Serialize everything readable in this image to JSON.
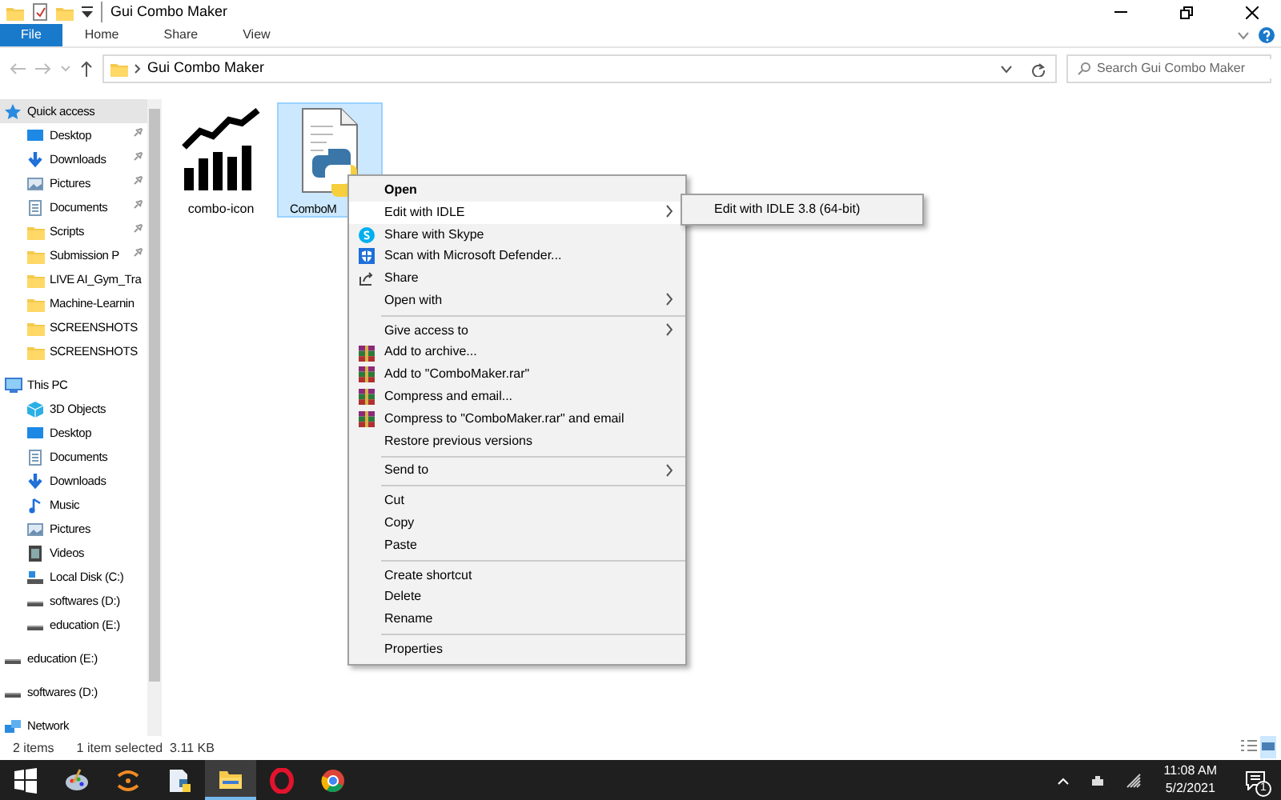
{
  "window": {
    "title": "Gui Combo Maker"
  },
  "ribbon_tabs": [
    {
      "label": "File",
      "selected": true
    },
    {
      "label": "Home",
      "selected": false
    },
    {
      "label": "Share",
      "selected": false
    },
    {
      "label": "View",
      "selected": false
    }
  ],
  "address": {
    "path": "Gui Combo Maker"
  },
  "search": {
    "placeholder": "Search Gui Combo Maker"
  },
  "sidebar": {
    "items": [
      {
        "label": "Quick access",
        "kind": "star",
        "selected": true,
        "children": [
          {
            "label": "Desktop",
            "kind": "desktop",
            "pinned": true
          },
          {
            "label": "Downloads",
            "kind": "download",
            "pinned": true
          },
          {
            "label": "Pictures",
            "kind": "pictures",
            "pinned": true
          },
          {
            "label": "Documents",
            "kind": "documents",
            "pinned": true
          },
          {
            "label": "Scripts",
            "kind": "folder",
            "pinned": true
          },
          {
            "label": "Submission P",
            "kind": "folder",
            "pinned": true
          },
          {
            "label": "LIVE AI_Gym_Tra",
            "kind": "folder",
            "pinned": false
          },
          {
            "label": "Machine-Learnin",
            "kind": "folder",
            "pinned": false
          },
          {
            "label": "SCREENSHOTS",
            "kind": "folder",
            "pinned": false
          },
          {
            "label": "SCREENSHOTS",
            "kind": "folder",
            "pinned": false
          }
        ]
      },
      {
        "label": "This PC",
        "kind": "pc",
        "selected": false,
        "children": [
          {
            "label": "3D Objects",
            "kind": "cube",
            "pinned": false
          },
          {
            "label": "Desktop",
            "kind": "desktop",
            "pinned": false
          },
          {
            "label": "Documents",
            "kind": "documents",
            "pinned": false
          },
          {
            "label": "Downloads",
            "kind": "download",
            "pinned": false
          },
          {
            "label": "Music",
            "kind": "music",
            "pinned": false
          },
          {
            "label": "Pictures",
            "kind": "pictures",
            "pinned": false
          },
          {
            "label": "Videos",
            "kind": "videos",
            "pinned": false
          },
          {
            "label": "Local Disk (C:)",
            "kind": "disk",
            "pinned": false
          },
          {
            "label": "softwares (D:)",
            "kind": "drive",
            "pinned": false
          },
          {
            "label": "education (E:)",
            "kind": "drive",
            "pinned": false
          }
        ]
      },
      {
        "label": "education (E:)",
        "kind": "drive",
        "selected": false
      },
      {
        "label": "softwares (D:)",
        "kind": "drive",
        "selected": false
      },
      {
        "label": "Network",
        "kind": "network",
        "selected": false
      }
    ]
  },
  "files": [
    {
      "label": "combo-icon",
      "kind": "chart",
      "selected": false
    },
    {
      "label": "ComboM",
      "kind": "python",
      "selected": true
    }
  ],
  "context_menu": [
    {
      "label": "Open",
      "kind": "plain",
      "default": true,
      "submenu": false,
      "selected": false
    },
    {
      "label": "Edit with IDLE",
      "kind": "plain",
      "default": false,
      "submenu": true,
      "selected": true
    },
    {
      "label": "Share with Skype",
      "kind": "skype",
      "default": false,
      "submenu": false,
      "selected": false
    },
    {
      "label": "Scan with Microsoft Defender...",
      "kind": "defender",
      "default": false,
      "submenu": false,
      "selected": false
    },
    {
      "label": "Share",
      "kind": "share",
      "default": false,
      "submenu": false,
      "selected": false
    },
    {
      "label": "Open with",
      "kind": "plain",
      "default": false,
      "submenu": true,
      "selected": false
    },
    {
      "kind": "separator"
    },
    {
      "label": "Give access to",
      "kind": "plain",
      "default": false,
      "submenu": true,
      "selected": false
    },
    {
      "label": "Add to archive...",
      "kind": "archive",
      "default": false,
      "submenu": false,
      "selected": false
    },
    {
      "label": "Add to \"ComboMaker.rar\"",
      "kind": "archive",
      "default": false,
      "submenu": false,
      "selected": false
    },
    {
      "label": "Compress and email...",
      "kind": "archive",
      "default": false,
      "submenu": false,
      "selected": false
    },
    {
      "label": "Compress to \"ComboMaker.rar\" and email",
      "kind": "archive",
      "default": false,
      "submenu": false,
      "selected": false
    },
    {
      "label": "Restore previous versions",
      "kind": "plain",
      "default": false,
      "submenu": false,
      "selected": false
    },
    {
      "kind": "separator"
    },
    {
      "label": "Send to",
      "kind": "plain",
      "default": false,
      "submenu": true,
      "selected": false
    },
    {
      "kind": "separator"
    },
    {
      "label": "Cut",
      "kind": "plain",
      "default": false,
      "submenu": false,
      "selected": false
    },
    {
      "label": "Copy",
      "kind": "plain",
      "default": false,
      "submenu": false,
      "selected": false
    },
    {
      "label": "Paste",
      "kind": "plain",
      "default": false,
      "submenu": false,
      "selected": false
    },
    {
      "kind": "separator"
    },
    {
      "label": "Create shortcut",
      "kind": "plain",
      "default": false,
      "submenu": false,
      "selected": false
    },
    {
      "label": "Delete",
      "kind": "plain",
      "default": false,
      "submenu": false,
      "selected": false
    },
    {
      "label": "Rename",
      "kind": "plain",
      "default": false,
      "submenu": false,
      "selected": false
    },
    {
      "kind": "separator"
    },
    {
      "label": "Properties",
      "kind": "plain",
      "default": false,
      "submenu": false,
      "selected": false
    }
  ],
  "submenu": [
    {
      "label": "Edit with IDLE 3.8 (64-bit)"
    }
  ],
  "status_bar": {
    "item_count": "2 items",
    "selection": "1 item selected  3.11 KB"
  },
  "taskbar": {
    "time": "11:08 AM",
    "date": "5/2/2021",
    "notifications": "1"
  }
}
